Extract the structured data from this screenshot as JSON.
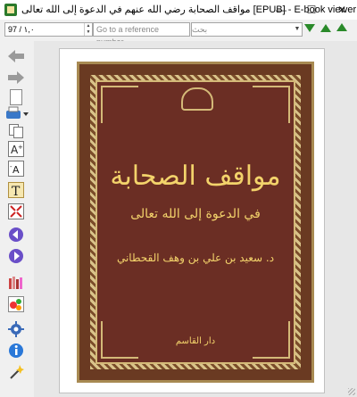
{
  "window": {
    "title": "مواقف الصحابة رضي الله عنهم في الدعوة إلى الله تعالى [EPUB] - E-book viewer",
    "minimize_glyph": "—",
    "maximize_glyph": "☐",
    "close_glyph": "✕"
  },
  "toolbar": {
    "position_value": "97 / ١,٠",
    "reference_placeholder": "Go to a reference number...",
    "search_placeholder": "بحث"
  },
  "book_cover": {
    "title": "مواقف الصحابة",
    "subtitle": "في الدعوة إلى الله تعالى",
    "author": "د. سعيد بن علي بن وهف القحطاني",
    "publisher": "دار القاسم"
  },
  "sidebar": {
    "icons": [
      "back-arrow-icon",
      "forward-arrow-icon",
      "blank-page-icon",
      "print-icon",
      "copy-icon",
      "font-larger-icon",
      "font-smaller-icon",
      "text-icon",
      "fullscreen-icon",
      "previous-page-icon",
      "next-page-icon",
      "library-icon",
      "toc-icon",
      "preferences-icon",
      "info-icon",
      "wand-icon"
    ]
  },
  "colors": {
    "accent_green": "#2a8a2a",
    "cover_maroon": "#6b2e24",
    "cover_gold": "#f3d36b"
  }
}
